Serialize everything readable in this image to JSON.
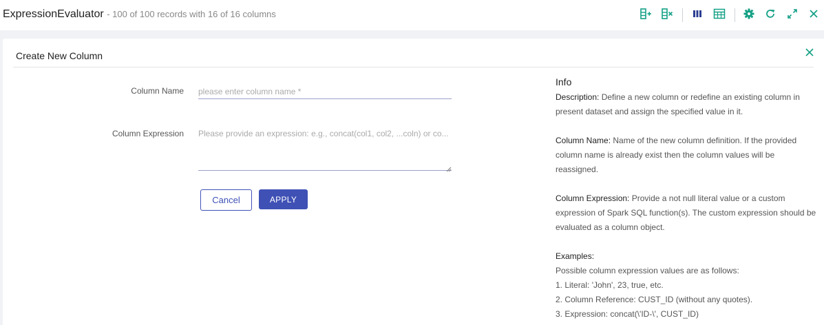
{
  "header": {
    "title": "ExpressionEvaluator",
    "subtitle": "- 100 of 100 records with 16 of 16 columns"
  },
  "colors": {
    "accent": "#3f51b5",
    "toolbar_teal": "#14a085",
    "toolbar_blue": "#2c3e91"
  },
  "toolbar": {
    "icons": [
      "add-column-icon",
      "remove-column-icon",
      "columns-view-icon",
      "table-view-icon",
      "settings-icon",
      "refresh-icon",
      "expand-icon",
      "close-icon"
    ]
  },
  "panel": {
    "title": "Create New Column",
    "form": {
      "column_name_label": "Column Name",
      "column_name_placeholder": "please enter column name *",
      "column_name_value": "",
      "column_expression_label": "Column Expression",
      "column_expression_placeholder": "Please provide an expression: e.g., concat(col1, col2, ...coln) or co...",
      "column_expression_value": "",
      "cancel_label": "Cancel",
      "apply_label": "APPLY"
    },
    "info": {
      "title": "Info",
      "description_label": "Description:",
      "description_text": "Define a new column or redefine an existing column in present dataset and assign the specified value in it.",
      "column_name_label": "Column Name:",
      "column_name_text": "Name of the new column definition. If the provided column name is already exist then the column values will be reassigned.",
      "column_expression_label": "Column Expression:",
      "column_expression_text": "Provide a not null literal value or a custom expression of Spark SQL function(s). The custom expression should be evaluated as a column object.",
      "examples_label": "Examples:",
      "examples_intro": "Possible column expression values are as follows:",
      "examples": [
        "1. Literal: 'John', 23, true, etc.",
        "2. Column Reference: CUST_ID (without any quotes).",
        "3. Expression: concat(\\'ID-\\', CUST_ID)"
      ]
    }
  }
}
